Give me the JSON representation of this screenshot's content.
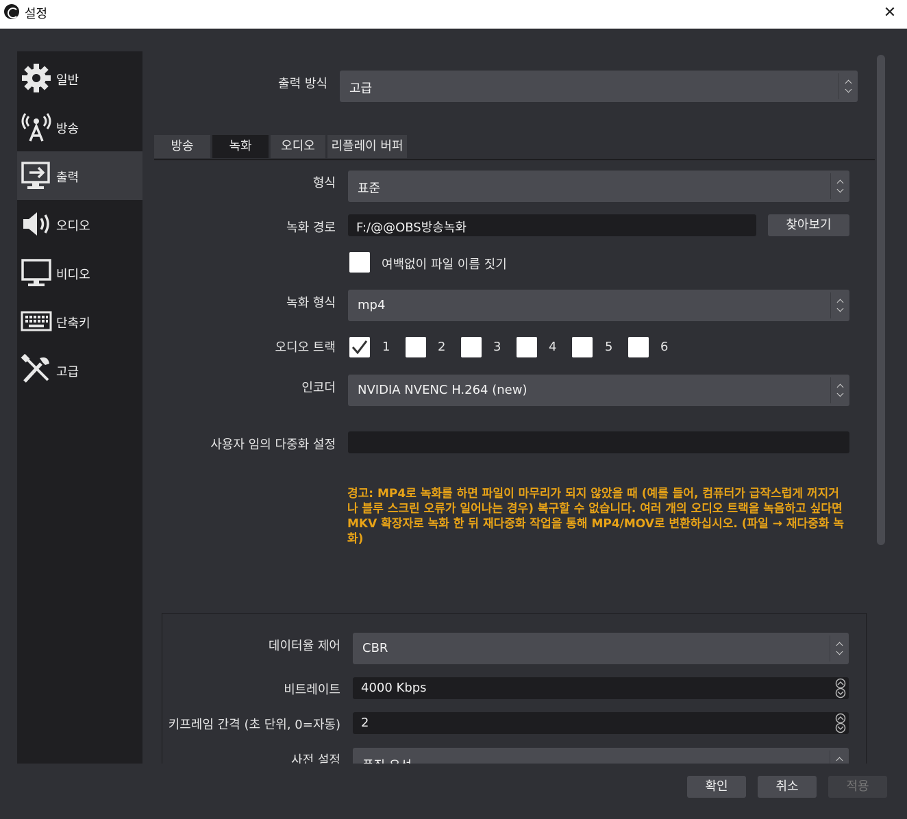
{
  "window": {
    "title": "설정",
    "close_glyph": "✕"
  },
  "sidebar": {
    "items": [
      {
        "label": "일반",
        "icon": "gear-icon"
      },
      {
        "label": "방송",
        "icon": "broadcast-icon"
      },
      {
        "label": "출력",
        "icon": "output-icon",
        "active": true
      },
      {
        "label": "오디오",
        "icon": "speaker-icon"
      },
      {
        "label": "비디오",
        "icon": "monitor-icon"
      },
      {
        "label": "단축키",
        "icon": "keyboard-icon"
      },
      {
        "label": "고급",
        "icon": "tools-icon"
      }
    ]
  },
  "output_mode": {
    "label": "출력 방식",
    "value": "고급"
  },
  "tabs": [
    {
      "label": "방송"
    },
    {
      "label": "녹화",
      "active": true
    },
    {
      "label": "오디오"
    },
    {
      "label": "리플레이 버퍼"
    }
  ],
  "recording": {
    "format_type": {
      "label": "형식",
      "value": "표준"
    },
    "path": {
      "label": "녹화 경로",
      "value": "F:/@@OBS방송녹화",
      "browse_label": "찾아보기"
    },
    "no_space": {
      "label": "여백없이 파일 이름 짓기",
      "checked": false
    },
    "rec_format": {
      "label": "녹화 형식",
      "value": "mp4"
    },
    "audio_tracks": {
      "label": "오디오 트랙",
      "tracks": [
        "1",
        "2",
        "3",
        "4",
        "5",
        "6"
      ],
      "checked": [
        true,
        false,
        false,
        false,
        false,
        false
      ]
    },
    "encoder": {
      "label": "인코더",
      "value": "NVIDIA NVENC H.264 (new)"
    },
    "muxer": {
      "label": "사용자 임의 다중화 설정",
      "value": ""
    },
    "warning": "경고: MP4로 녹화를 하면 파일이 마무리가 되지 않았을 때 (예를 들어, 컴퓨터가 급작스럽게 꺼지거나 블루 스크린 오류가 일어나는 경우) 복구할 수 없습니다. 여러 개의 오디오 트랙을 녹음하고 싶다면 MKV 확장자로 녹화 한 뒤 재다중화 작업을 통해 MP4/MOV로 변환하십시오. (파일 → 재다중화 녹화)"
  },
  "encoder_settings": {
    "rate_control": {
      "label": "데이터율 제어",
      "value": "CBR"
    },
    "bitrate": {
      "label": "비트레이트",
      "value": "4000 Kbps"
    },
    "keyframe": {
      "label": "키프레임 간격 (초 단위, 0=자동)",
      "value": "2"
    },
    "preset": {
      "label": "사전 설정",
      "value": "품질 우선"
    }
  },
  "footer": {
    "ok": "확인",
    "cancel": "취소",
    "apply": "적용"
  },
  "colors": {
    "warning": "#e8a317",
    "background": "#2f3035",
    "sidebar": "#1f1f22",
    "field": "#4a4b51",
    "input": "#1d1d20"
  }
}
